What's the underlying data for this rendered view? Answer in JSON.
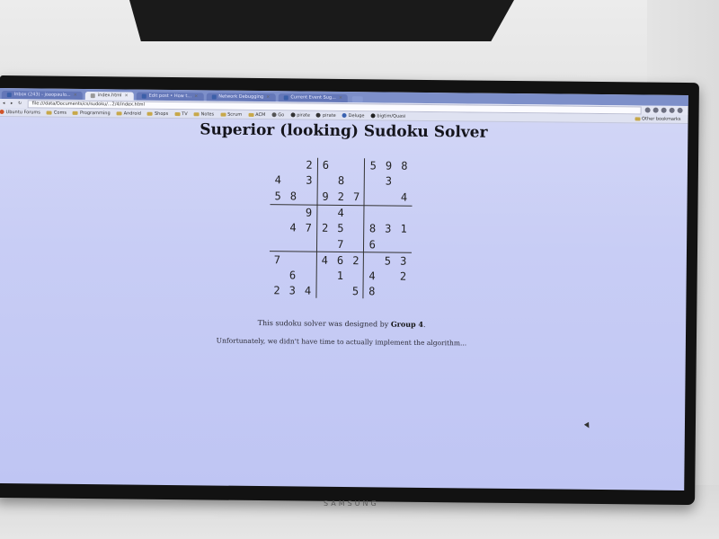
{
  "browser": {
    "tabs": [
      {
        "label": "Inbox (243) - joaopaulo...",
        "active": false
      },
      {
        "label": "index.html",
        "active": true
      },
      {
        "label": "Edit post • How t...",
        "active": false
      },
      {
        "label": "Network Debugging",
        "active": false
      },
      {
        "label": "Current Event Sug...",
        "active": false
      }
    ],
    "url": "file:///data/Documents/cs/sudoku/...2/4/index.html",
    "bookmarks": [
      "Ubuntu Forums",
      "Coms",
      "Programming",
      "Android",
      "Shops",
      "TV",
      "Notes",
      "Scrum",
      "ACM",
      "Go",
      "pirate",
      "pirate",
      "Deluge",
      "bigtim/Quasi"
    ],
    "other_bookmarks": "Other bookmarks"
  },
  "page": {
    "title": "Superior (looking) Sudoku Solver",
    "credit_prefix": "This sudoku solver was designed by",
    "credit_group": "Group 4",
    "credit_suffix": ".",
    "note": "Unfortunately, we didn't have time to actually implement the algorithm..."
  },
  "sudoku": {
    "rows": [
      [
        "",
        "",
        "2",
        "6",
        "",
        "",
        "5",
        "9",
        "8"
      ],
      [
        "4",
        "",
        "3",
        "",
        "8",
        "",
        "",
        "3",
        ""
      ],
      [
        "5",
        "8",
        "",
        "9",
        "2",
        "7",
        "",
        "",
        "4"
      ],
      [
        "",
        "",
        "9",
        "",
        "4",
        "",
        "",
        "",
        ""
      ],
      [
        "",
        "4",
        "7",
        "2",
        "5",
        "",
        "8",
        "3",
        "1"
      ],
      [
        "",
        "",
        "",
        "",
        "7",
        "",
        "6",
        "",
        ""
      ],
      [
        "7",
        "",
        "",
        "4",
        "6",
        "2",
        "",
        "5",
        "3"
      ],
      [
        "",
        "6",
        "",
        "",
        "1",
        "",
        "4",
        "",
        "2"
      ],
      [
        "2",
        "3",
        "4",
        "",
        "",
        "5",
        "8",
        "",
        ""
      ]
    ]
  },
  "monitor": {
    "brand": "SAMSUNG"
  }
}
